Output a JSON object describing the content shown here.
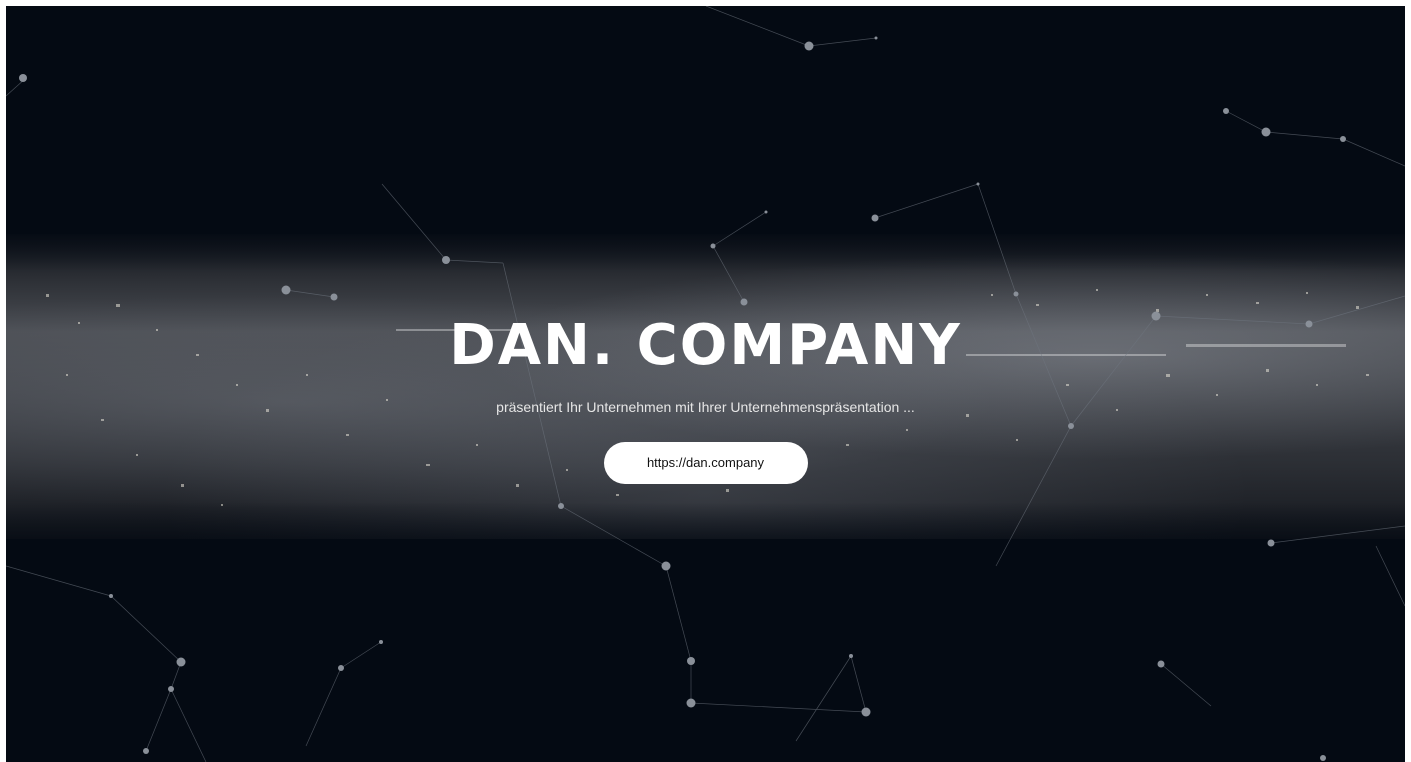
{
  "hero": {
    "title": "DAN. COMPANY",
    "subtitle": "präsentiert Ihr Unternehmen mit Ihrer Unternehmenspräsentation ...",
    "link_label": "https://dan.company"
  },
  "colors": {
    "background": "#040a13",
    "text": "#ffffff",
    "button_background": "#ffffff",
    "button_text": "#111111"
  }
}
